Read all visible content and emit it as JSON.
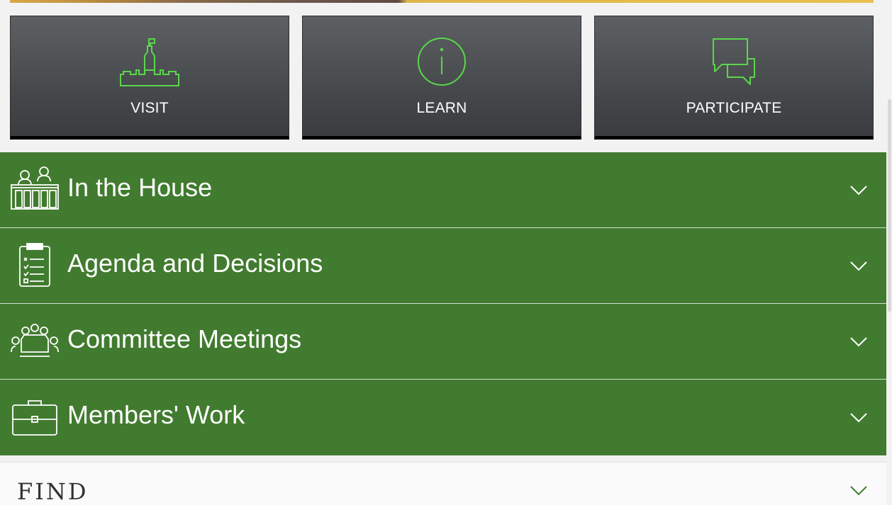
{
  "tiles": [
    {
      "label": "VISIT",
      "icon": "parliament-building-icon"
    },
    {
      "label": "LEARN",
      "icon": "info-icon"
    },
    {
      "label": "PARTICIPATE",
      "icon": "chat-bubbles-icon"
    }
  ],
  "accordion": [
    {
      "label": "In the House",
      "icon": "house-chamber-icon"
    },
    {
      "label": "Agenda and Decisions",
      "icon": "clipboard-checklist-icon"
    },
    {
      "label": "Committee Meetings",
      "icon": "meeting-table-icon"
    },
    {
      "label": "Members' Work",
      "icon": "briefcase-icon"
    }
  ],
  "find": {
    "label": "FIND",
    "icon": "chevron-down-icon"
  },
  "colors": {
    "accordion_bg": "#417b2f",
    "tile_icon_stroke": "#59d84a",
    "tile_bg": "#4a4d50",
    "find_chevron": "#3f7d2d"
  }
}
